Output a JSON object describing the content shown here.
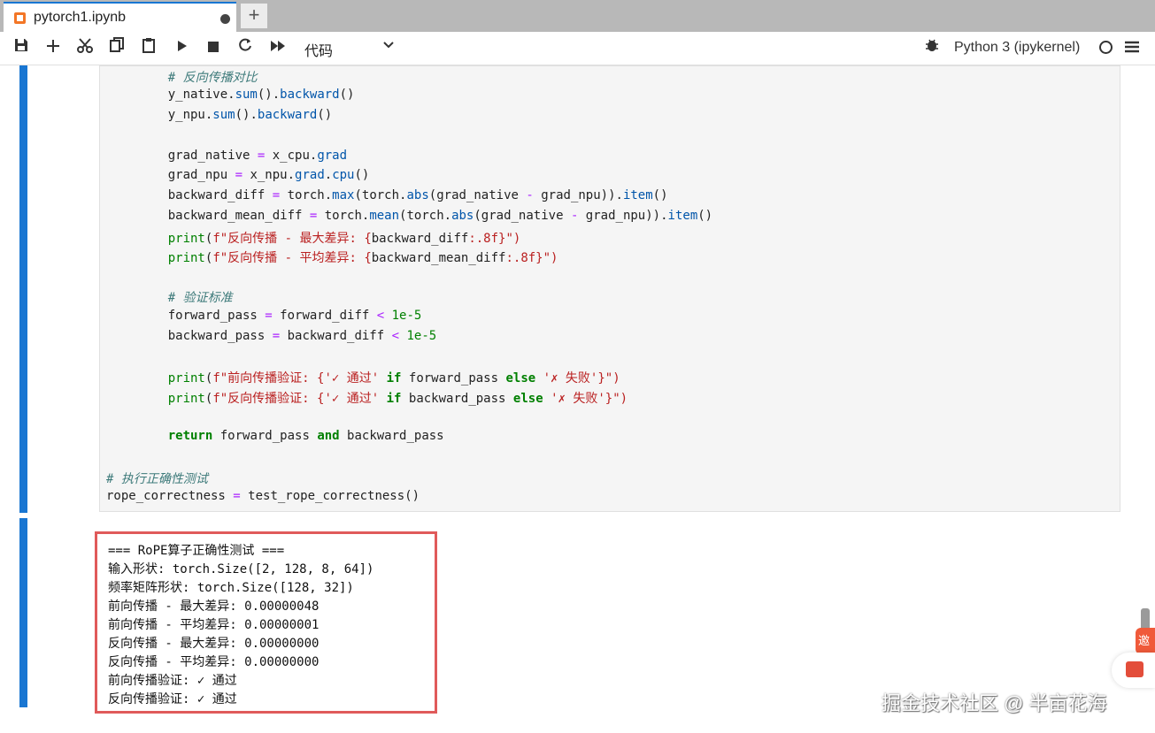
{
  "tab": {
    "title": "pytorch1.ipynb",
    "new_tab": "+"
  },
  "toolbar": {
    "cell_type": "代码",
    "kernel": "Python 3 (ipykernel)"
  },
  "icons": [
    "save-icon",
    "add-cell-icon",
    "cut-icon",
    "copy-icon",
    "paste-icon",
    "run-icon",
    "stop-icon",
    "restart-icon",
    "fast-forward-icon",
    "chevron-down-icon",
    "bug-icon",
    "kernel-status-icon",
    "menu-icon"
  ],
  "code": {
    "lines": [
      "    # 反向传播对比",
      "    y_native.sum().backward()",
      "    y_npu.sum().backward()",
      "",
      "    grad_native = x_cpu.grad",
      "    grad_npu = x_npu.grad.cpu()",
      "    backward_diff = torch.max(torch.abs(grad_native - grad_npu)).item()",
      "    backward_mean_diff = torch.mean(torch.abs(grad_native - grad_npu)).item()",
      "    print(f\"反向传播 - 最大差异: {backward_diff:.8f}\")",
      "    print(f\"反向传播 - 平均差异: {backward_mean_diff:.8f}\")",
      "",
      "    # 验证标准",
      "    forward_pass = forward_diff < 1e-5",
      "    backward_pass = backward_diff < 1e-5",
      "",
      "    print(f\"前向传播验证: {'✓ 通过' if forward_pass else '✗ 失败'}\")",
      "    print(f\"反向传播验证: {'✓ 通过' if backward_pass else '✗ 失败'}\")",
      "",
      "    return forward_pass and backward_pass",
      "",
      "# 执行正确性测试",
      "rope_correctness = test_rope_correctness()"
    ]
  },
  "output": {
    "lines": [
      "=== RoPE算子正确性测试 ===",
      "输入形状: torch.Size([2, 128, 8, 64])",
      "频率矩阵形状: torch.Size([128, 32])",
      "前向传播 - 最大差异: 0.00000048",
      "前向传播 - 平均差异: 0.00000001",
      "反向传播 - 最大差异: 0.00000000",
      "反向传播 - 平均差异: 0.00000000",
      "前向传播验证: ✓ 通过",
      "反向传播验证: ✓ 通过"
    ]
  },
  "promo": {
    "label": "邀"
  },
  "watermark": "掘金技术社区 @ 半亩花海",
  "colors": {
    "accent": "#1976d2",
    "highlight_border": "#e05a5a",
    "promo": "#f05a3a"
  }
}
